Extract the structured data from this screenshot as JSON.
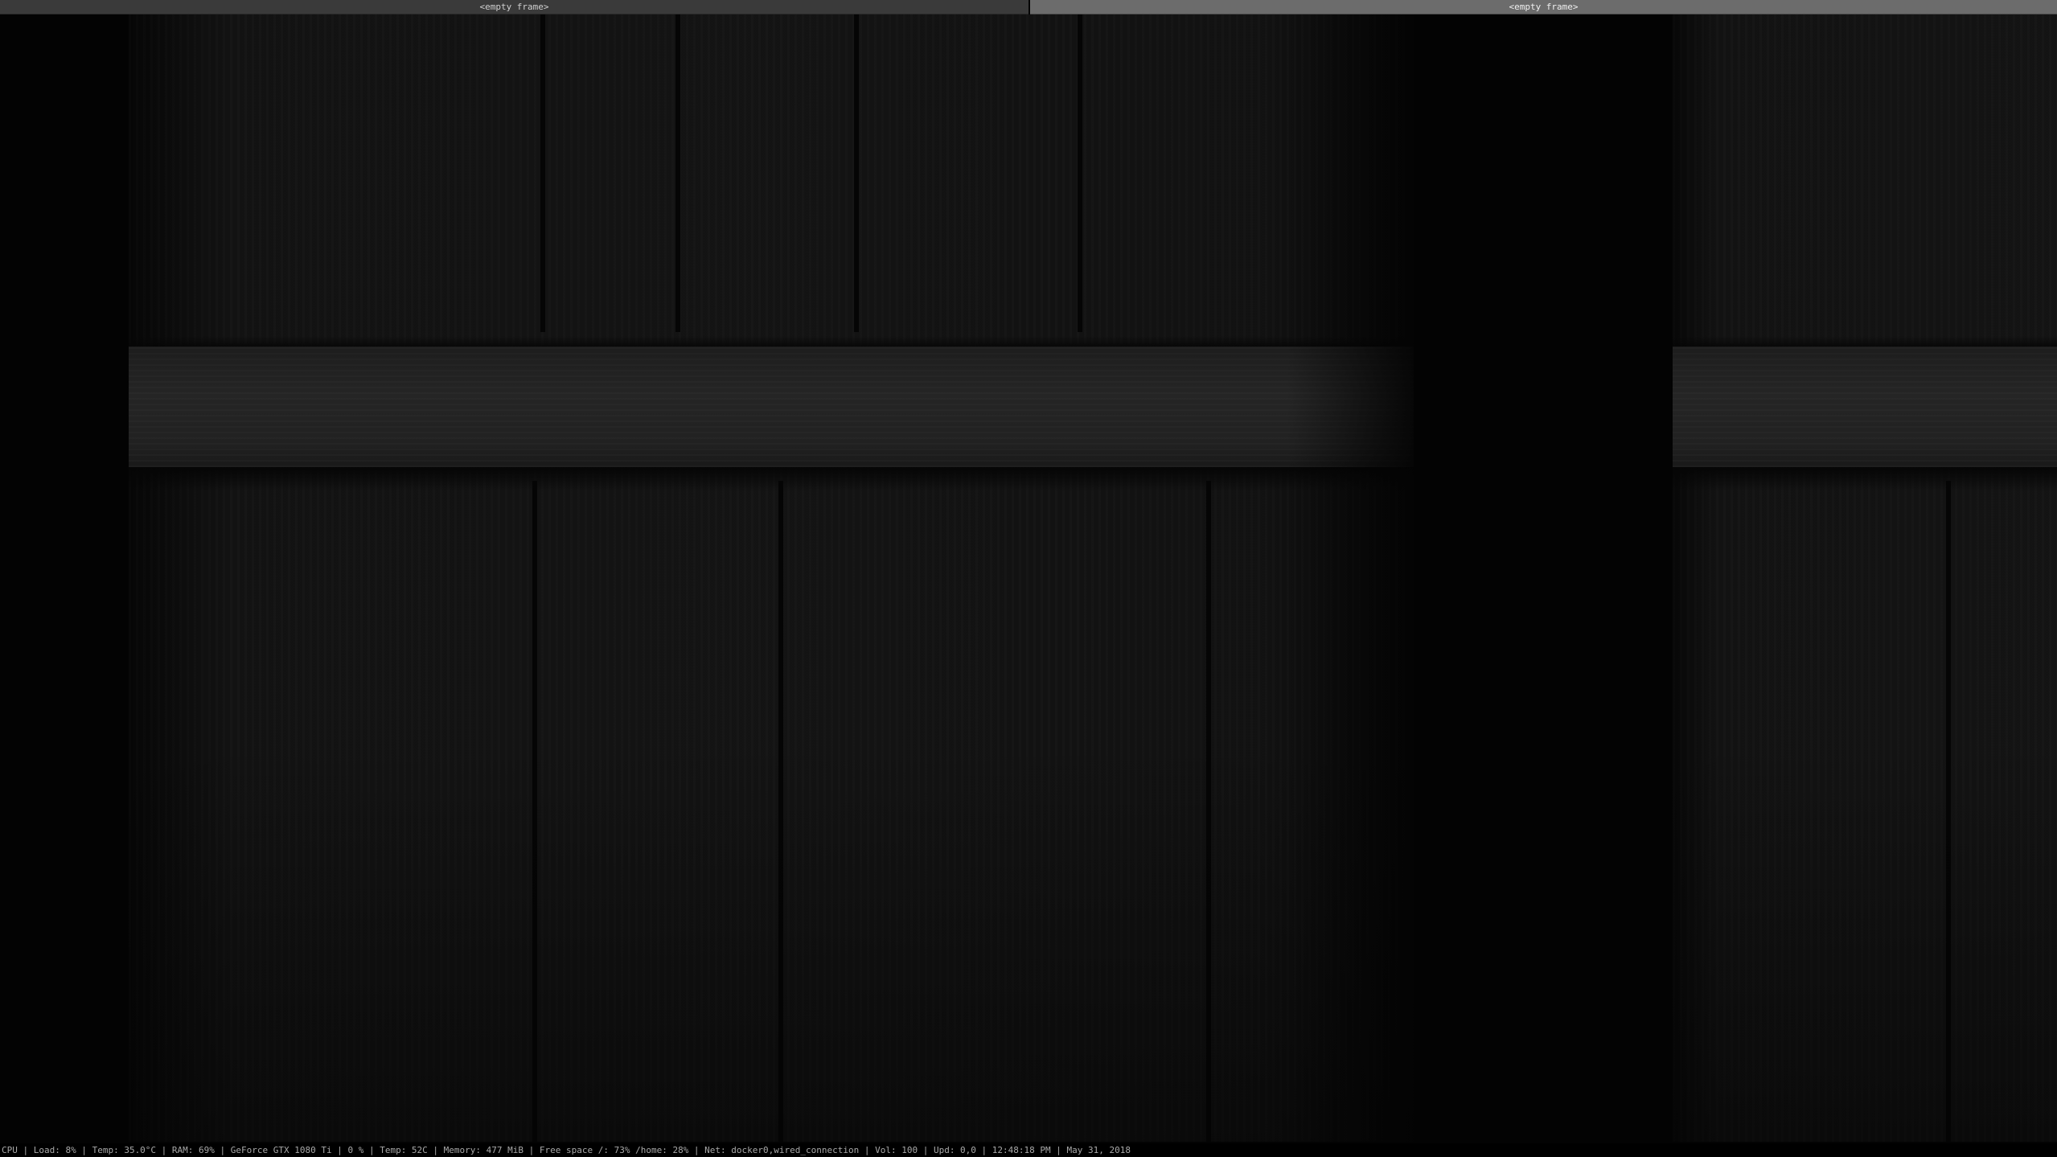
{
  "frames": {
    "left": {
      "title": "<empty frame>"
    },
    "right": {
      "title": "<empty frame>"
    }
  },
  "statusbar": {
    "text": "CPU | Load: 8% | Temp: 35.0°C | RAM: 69% | GeForce GTX 1080 Ti | 0 % | Temp: 52C | Memory: 477 MiB | Free space /: 73% /home: 28% | Net: docker0,wired_connection | Vol: 100 | Upd: 0,0 | 12:48:18 PM | May 31, 2018"
  },
  "colors": {
    "active_frame_bar": "#6c6c6c",
    "inactive_frame_bar": "#3a3a3a",
    "background": "#030303",
    "statusbar_text": "#a8a8a8"
  }
}
